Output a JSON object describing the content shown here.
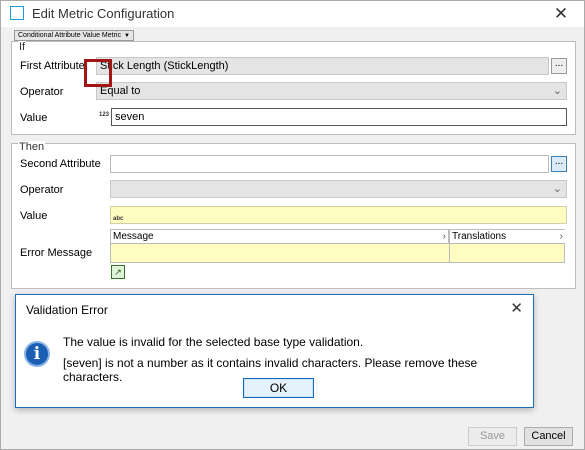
{
  "window": {
    "title": "Edit Metric Configuration",
    "close_glyph": "✕"
  },
  "metric_type": {
    "value": "Conditional Attribute Value Metric",
    "caret": "▼"
  },
  "if_section": {
    "label": "If",
    "first_attribute_label": "First Attribute",
    "first_attribute_value": "Stick Length (StickLength)",
    "browse_glyph": "...",
    "operator_label": "Operator",
    "operator_value": "Equal to",
    "value_label": "Value",
    "value_type_icon": "123",
    "value_input": "seven"
  },
  "then_section": {
    "label": "Then",
    "second_attribute_label": "Second Attribute",
    "second_attribute_value": "",
    "browse_glyph": "...",
    "operator_label": "Operator",
    "value_label": "Value",
    "value_type_icon": "abc",
    "error_message_label": "Error Message",
    "grid_columns": [
      "Message",
      "Translations"
    ],
    "column_arrow": "›",
    "add_glyph": "↗"
  },
  "dialog": {
    "title": "Validation Error",
    "close_glyph": "✕",
    "icon_glyph": "i",
    "line1": "The value is invalid for the selected base type validation.",
    "line2": "[seven] is not a number as it contains invalid characters. Please remove these characters.",
    "ok_label": "OK"
  },
  "footer": {
    "save_label": "Save",
    "cancel_label": "Cancel"
  },
  "colors": {
    "accent": "#1a6fb6",
    "highlight": "#a31515",
    "field_yellow": "#fffcc2"
  }
}
